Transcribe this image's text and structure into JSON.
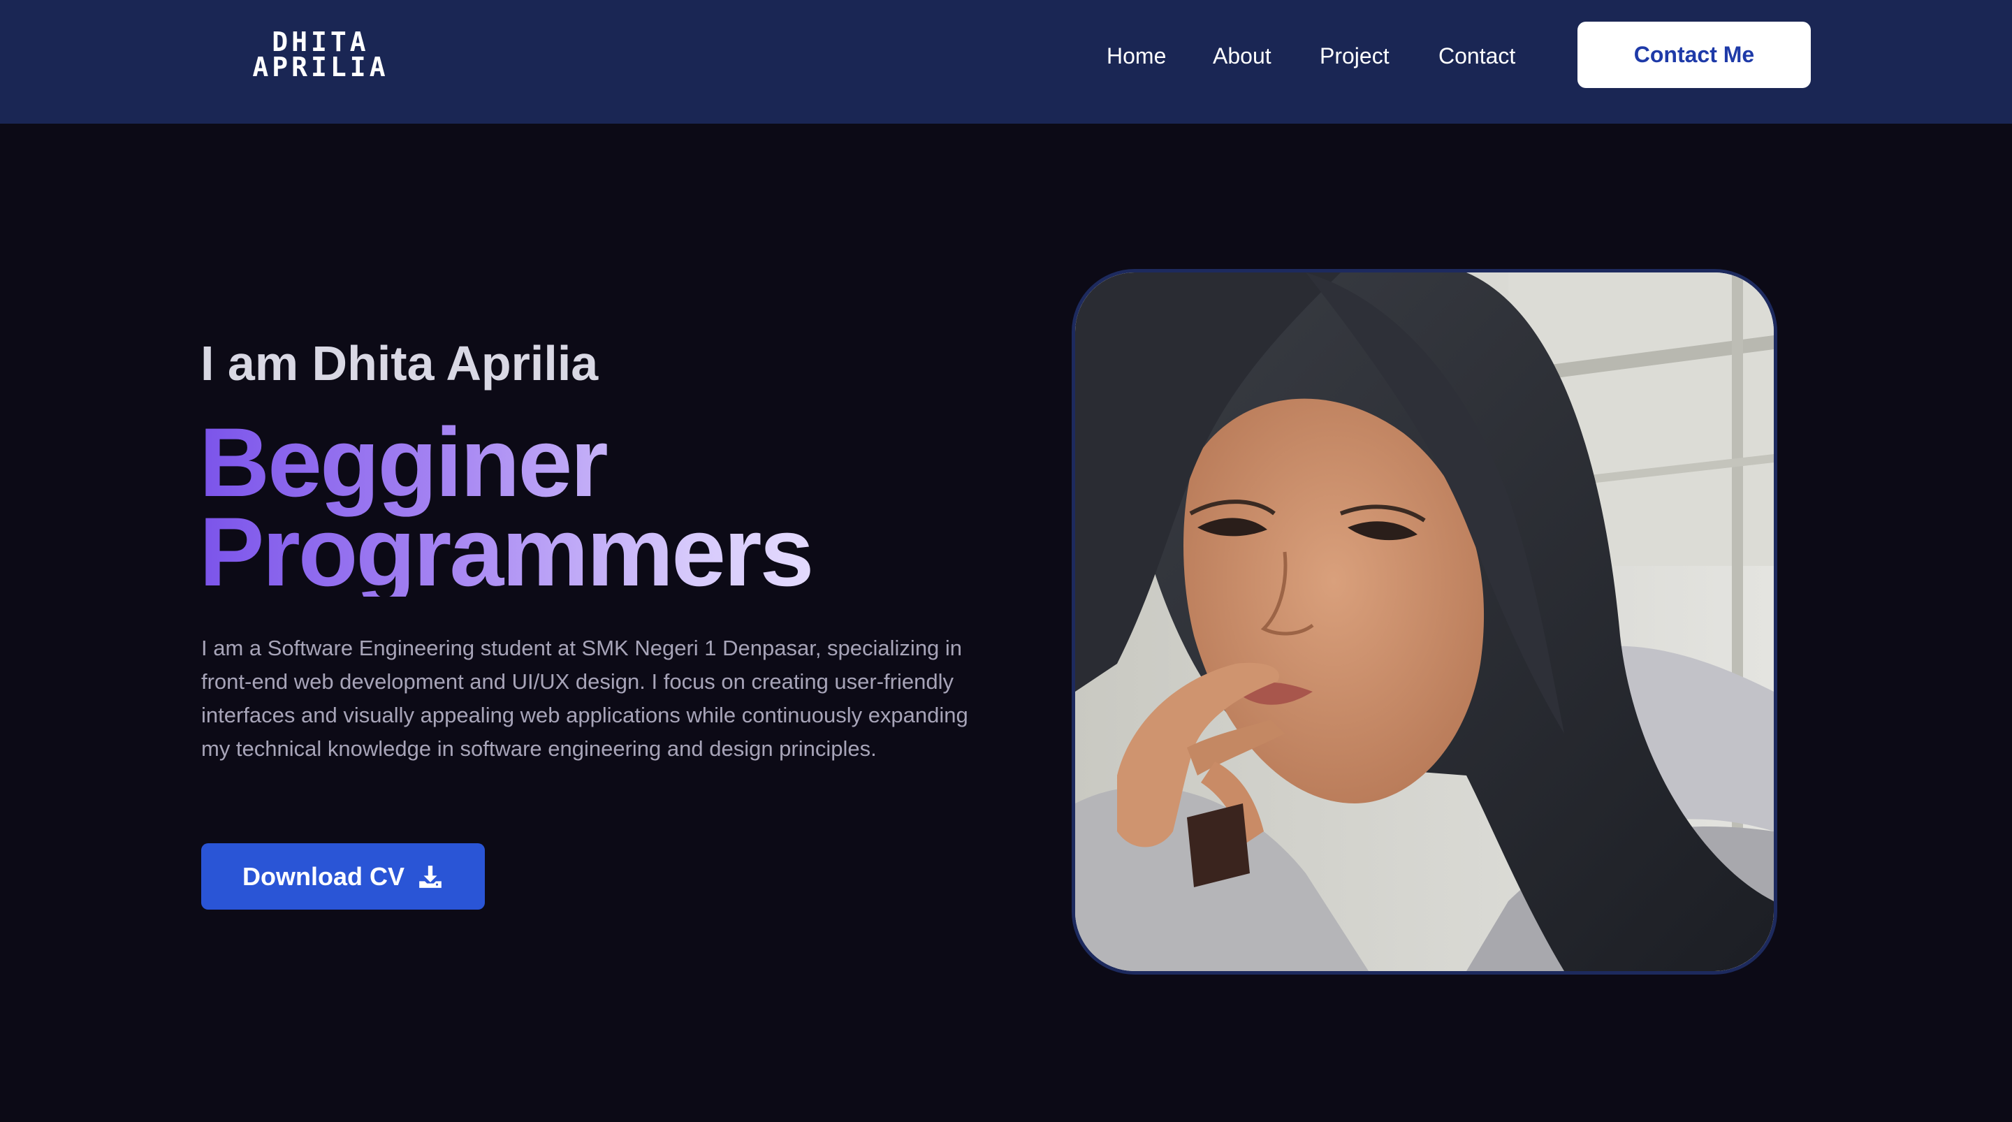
{
  "nav": {
    "logo_line1": "DHITA",
    "logo_line2": "APRILIA",
    "links": [
      "Home",
      "About",
      "Project",
      "Contact"
    ],
    "cta_label": "Contact Me"
  },
  "hero": {
    "greeting": "I am Dhita Aprilia",
    "headline_line1": "Begginer",
    "headline_line2": "Programmers",
    "bio": "I am a Software Engineering student at SMK Negeri 1 Denpasar, specializing in front-end web development and UI/UX design. I focus on creating user-friendly interfaces and visually appealing web applications while continuously expanding my technical knowledge in software engineering and design principles.",
    "download_label": "Download CV",
    "download_icon": "download-icon",
    "photo_icon": "profile-photo"
  },
  "colors": {
    "nav_bg": "#1a2654",
    "page_bg": "#0c0a16",
    "accent": "#2a55d6",
    "gradient_start": "#7b54ea",
    "gradient_end": "#ece6ff"
  }
}
